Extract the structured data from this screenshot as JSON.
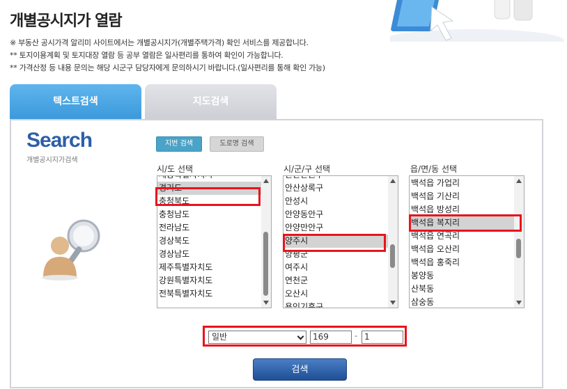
{
  "page": {
    "title": "개별공시지가 열람",
    "notices": [
      "※ 부동산 공시가격 알리미 사이트에서는 개별공시지가(개별주택가격) 확인 서비스를 제공합니다.",
      "** 토지이용계획 및 토지대장 열람 등 공부 열람은 일사편리를 통하여 확인이 가능합니다.",
      "** 가격산정 등 내용 문의는 해당 시군구 담당자에게 문의하시기 바랍니다.(일사편리를 통해 확인 가능)"
    ]
  },
  "tabs": [
    {
      "label": "텍스트검색",
      "active": true
    },
    {
      "label": "지도검색",
      "active": false
    }
  ],
  "panel": {
    "logo": "Search",
    "logo_sub": "개별공시지가검색",
    "search_type_buttons": {
      "jibun": "지번 검색",
      "road": "도로명 검색"
    }
  },
  "columns": {
    "sido": {
      "label": "시/도 선택",
      "items": [
        "세종특별자치시",
        "경기도",
        "충청북도",
        "충청남도",
        "전라남도",
        "경상북도",
        "경상남도",
        "제주특별자치도",
        "강원특별자치도",
        "전북특별자치도"
      ],
      "selected": "경기도"
    },
    "sigungu": {
      "label": "시/군/구 선택",
      "items": [
        "안산단원구",
        "안산상록구",
        "안성시",
        "안양동안구",
        "안양만안구",
        "양주시",
        "양평군",
        "여주시",
        "연천군",
        "오산시",
        "용인기흥구"
      ],
      "selected": "양주시"
    },
    "eupmyeondong": {
      "label": "읍/면/동 선택",
      "items": [
        "백석읍 가업리",
        "백석읍 기산리",
        "백석읍 방성리",
        "백석읍 복지리",
        "백석읍 연곡리",
        "백석읍 오산리",
        "백석읍 홍죽리",
        "봉양동",
        "산북동",
        "삼숭동"
      ],
      "selected": "백석읍 복지리"
    }
  },
  "form": {
    "land_type": "일반",
    "main_number": "169",
    "dash": "-",
    "sub_number": "1"
  },
  "search_button": "검색",
  "colors": {
    "accent_tab": "#3a98da",
    "highlight": "#e8141c",
    "button": "#1f4f96"
  }
}
